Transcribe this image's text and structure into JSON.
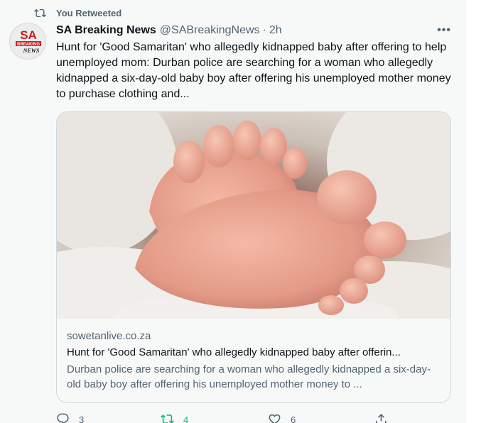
{
  "retweet_banner": "You Retweeted",
  "author": {
    "name": "SA Breaking News",
    "handle": "@SABreakingNews",
    "separator": "·",
    "time": "2h",
    "avatar_text_top": "SA",
    "avatar_text_mid": "BREAKING",
    "avatar_text_bottom": "NEWS"
  },
  "more_label": "•••",
  "tweet_text": "Hunt for 'Good Samaritan' who allegedly kidnapped baby after offering to help unemployed mom: Durban police are searching for a woman who allegedly kidnapped a six-day-old baby boy after offering his unemployed mother money to purchase clothing and...",
  "card": {
    "domain": "sowetanlive.co.za",
    "title": "Hunt for 'Good Samaritan' who allegedly kidnapped baby after offerin...",
    "description": "Durban police are searching for a woman who allegedly kidnapped a six-day-old baby boy after offering his unemployed mother money to ..."
  },
  "actions": {
    "reply_count": "3",
    "retweet_count": "4",
    "like_count": "6"
  },
  "icons": {
    "retweet_banner": "retweet-icon",
    "more": "more-icon",
    "reply": "reply-icon",
    "retweet": "retweet-icon",
    "like": "heart-icon",
    "share": "share-icon"
  },
  "colors": {
    "secondary_text": "#536471",
    "primary_text": "#0f1419",
    "retweet_active": "#00ba7c",
    "border": "#cfd9de"
  }
}
